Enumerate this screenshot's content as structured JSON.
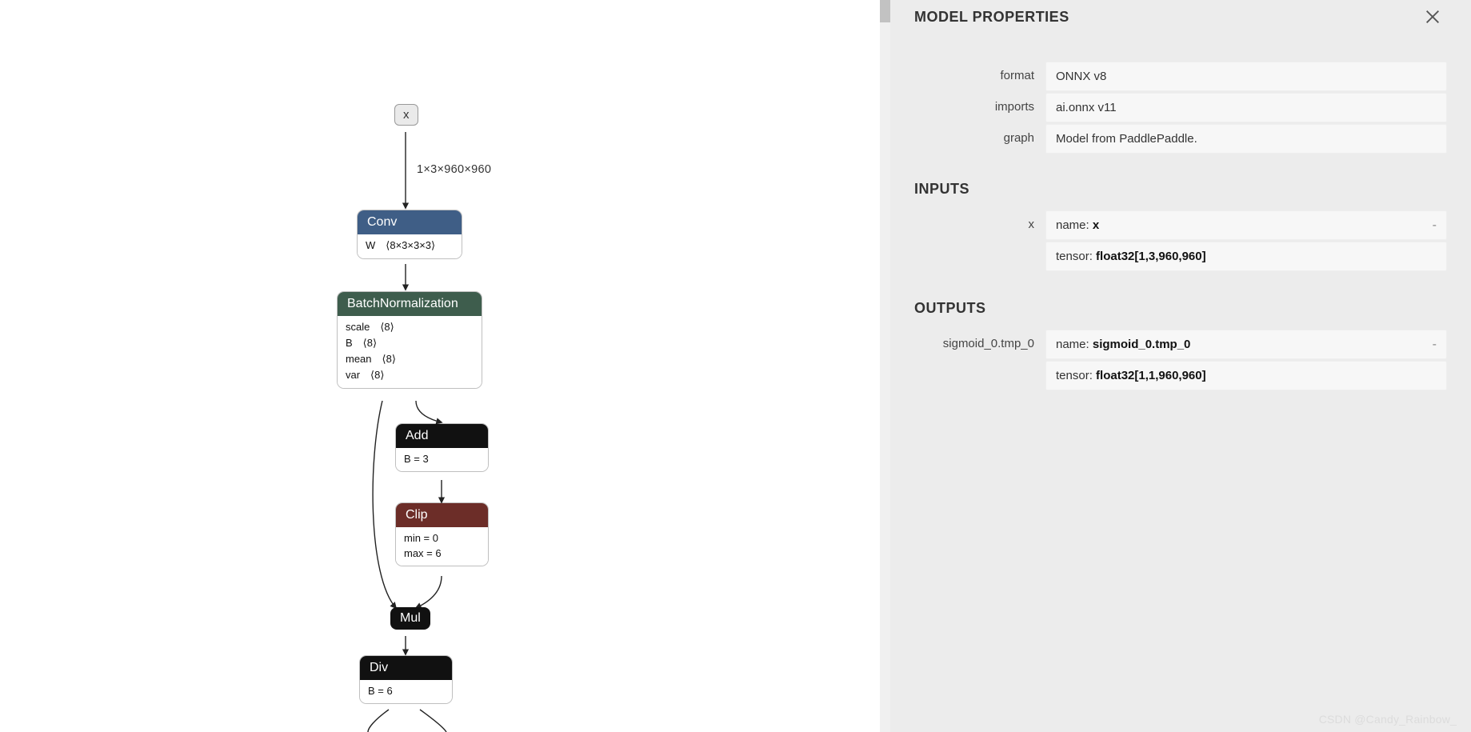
{
  "panel": {
    "title": "MODEL PROPERTIES",
    "properties": [
      {
        "label": "format",
        "value": "ONNX v8"
      },
      {
        "label": "imports",
        "value": "ai.onnx v11"
      },
      {
        "label": "graph",
        "value": "Model from PaddlePaddle."
      }
    ],
    "inputs_title": "INPUTS",
    "outputs_title": "OUTPUTS",
    "inputs": [
      {
        "label": "x",
        "name_prefix": "name: ",
        "name": "x",
        "tensor_prefix": "tensor: ",
        "tensor": "float32[1,3,960,960]"
      }
    ],
    "outputs": [
      {
        "label": "sigmoid_0.tmp_0",
        "name_prefix": "name: ",
        "name": "sigmoid_0.tmp_0",
        "tensor_prefix": "tensor: ",
        "tensor": "float32[1,1,960,960]"
      }
    ]
  },
  "graph": {
    "input_box": "x",
    "input_dims_label": "1×3×960×960",
    "nodes": {
      "conv": {
        "title": "Conv",
        "attrs": [
          "W ⟨8×3×3×3⟩"
        ]
      },
      "bn": {
        "title": "BatchNormalization",
        "attrs": [
          "scale ⟨8⟩",
          "B ⟨8⟩",
          "mean ⟨8⟩",
          "var ⟨8⟩"
        ]
      },
      "add": {
        "title": "Add",
        "attrs": [
          "B = 3"
        ]
      },
      "clip": {
        "title": "Clip",
        "attrs": [
          "min = 0",
          "max = 6"
        ]
      },
      "mul": {
        "title": "Mul"
      },
      "div": {
        "title": "Div",
        "attrs": [
          "B = 6"
        ]
      }
    }
  },
  "watermark": "CSDN @Candy_Rainbow_"
}
